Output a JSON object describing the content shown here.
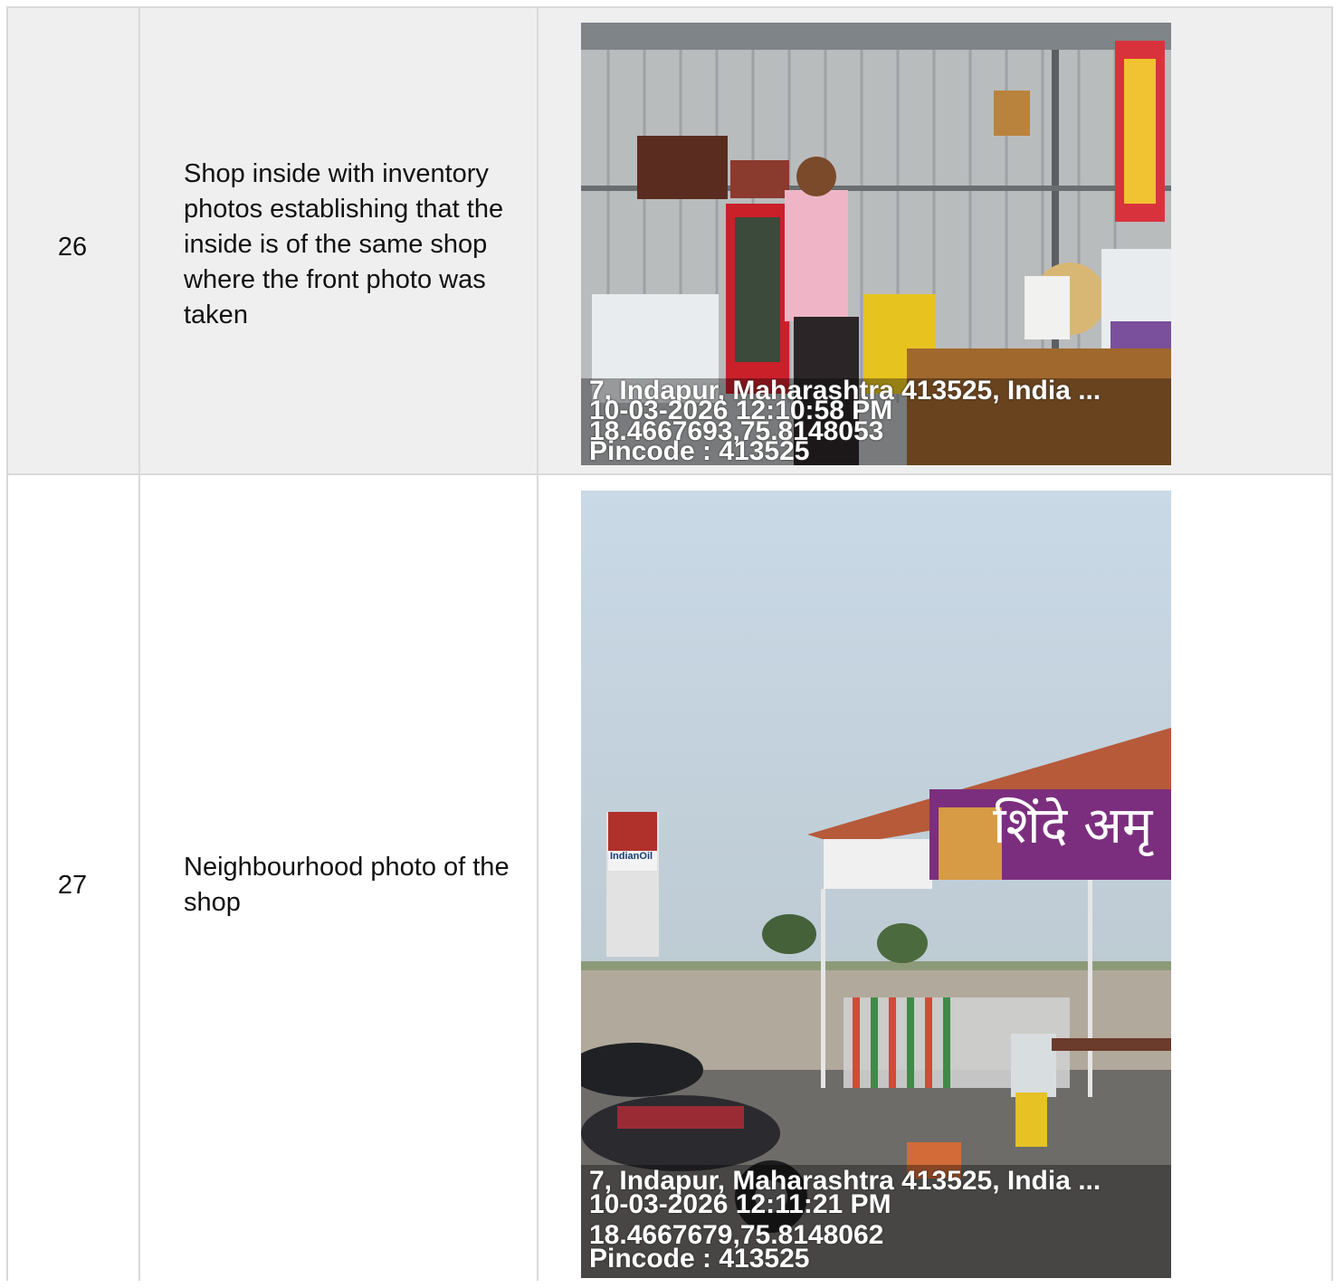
{
  "rows": [
    {
      "number": "26",
      "description": "Shop inside with inventory photos establishing that the inside is of the same shop where the front photo was taken",
      "photo": {
        "subject": "shop-interior-with-shopkeeper",
        "address": "7, Indapur, Maharashtra 413525, India ...",
        "datetime": "10-03-2026 12:10:58 PM",
        "coords": "18.4667693,75.8148053",
        "pincode": "Pincode : 413525"
      }
    },
    {
      "number": "27",
      "description": "Neighbourhood photo of the shop",
      "photo": {
        "subject": "shop-neighbourhood-exterior",
        "address": "7, Indapur, Maharashtra 413525, India ...",
        "datetime": "10-03-2026 12:11:21 PM",
        "coords": "18.4667679,75.8148062",
        "pincode": "Pincode : 413525",
        "signs": {
          "brand_sign": "IndianOil",
          "shop_sign_marathi": "शिंदे अमृ"
        }
      }
    }
  ]
}
